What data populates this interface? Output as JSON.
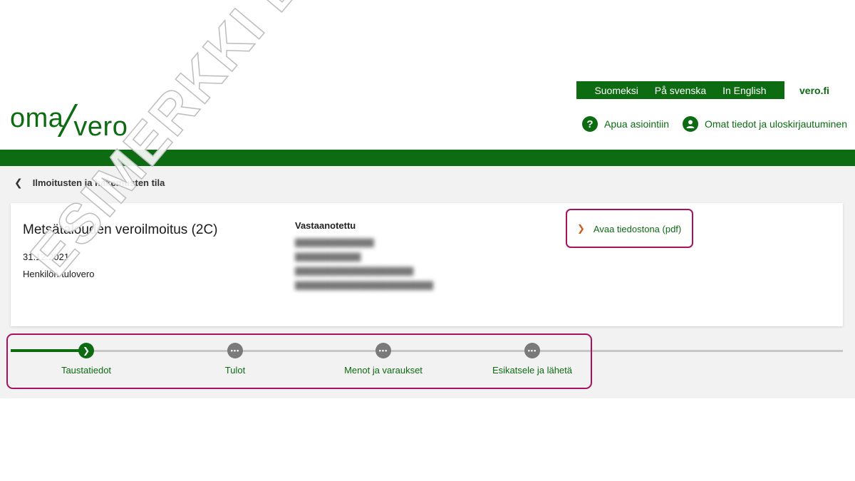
{
  "header": {
    "logo_part1": "oma",
    "logo_part2": "vero",
    "languages": [
      "Suomeksi",
      "På svenska",
      "In English"
    ],
    "site_link": "vero.fi",
    "help_label": "Apua asiointiin",
    "user_label": "Omat tiedot ja uloskirjautuminen"
  },
  "nav": {
    "back_label": "Ilmoitusten ja hakemusten tila"
  },
  "card": {
    "title": "Metsätalouden veroilmoitus (2C)",
    "date": "31.12.2021",
    "type": "Henkilön tulovero",
    "status_heading": "Vastaanotettu",
    "pdf_link": "Avaa tiedostona (pdf)"
  },
  "progress": {
    "steps": [
      {
        "label": "Taustatiedot",
        "state": "active"
      },
      {
        "label": "Tulot",
        "state": "todo"
      },
      {
        "label": "Menot ja varaukset",
        "state": "todo"
      },
      {
        "label": "Esikatsele ja lähetä",
        "state": "todo"
      }
    ]
  },
  "watermark": "ESIMERKKI ESIMERKKI",
  "colors": {
    "brand_green": "#0d6b12",
    "highlight": "#a8115e",
    "link_arrow": "#d05a1a"
  }
}
